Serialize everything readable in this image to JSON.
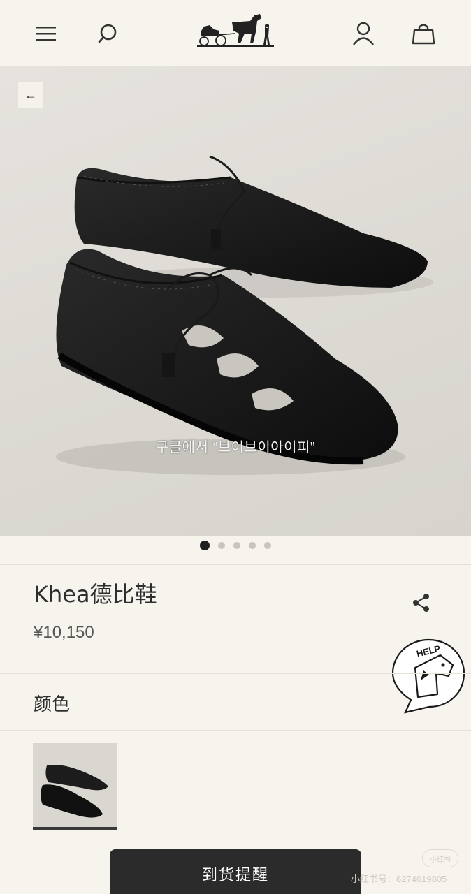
{
  "header": {
    "menu_icon": "hamburger-menu-icon",
    "search_icon": "search-icon",
    "logo": "hermes-carriage-logo",
    "account_icon": "user-icon",
    "cart_icon": "shopping-bag-icon"
  },
  "gallery": {
    "back_icon": "←",
    "overlay_text": "구글에서 “브이브이아이피”",
    "image_count": 5,
    "active_index": 0
  },
  "product": {
    "title": "Khea德比鞋",
    "price": "¥10,150",
    "share_icon": "share-icon"
  },
  "help": {
    "label": "HELP"
  },
  "color_section": {
    "label": "颜色"
  },
  "cta": {
    "label": "到货提醒"
  },
  "footer_watermark": {
    "text": "小红书号：6274619805",
    "badge": "小红书"
  }
}
